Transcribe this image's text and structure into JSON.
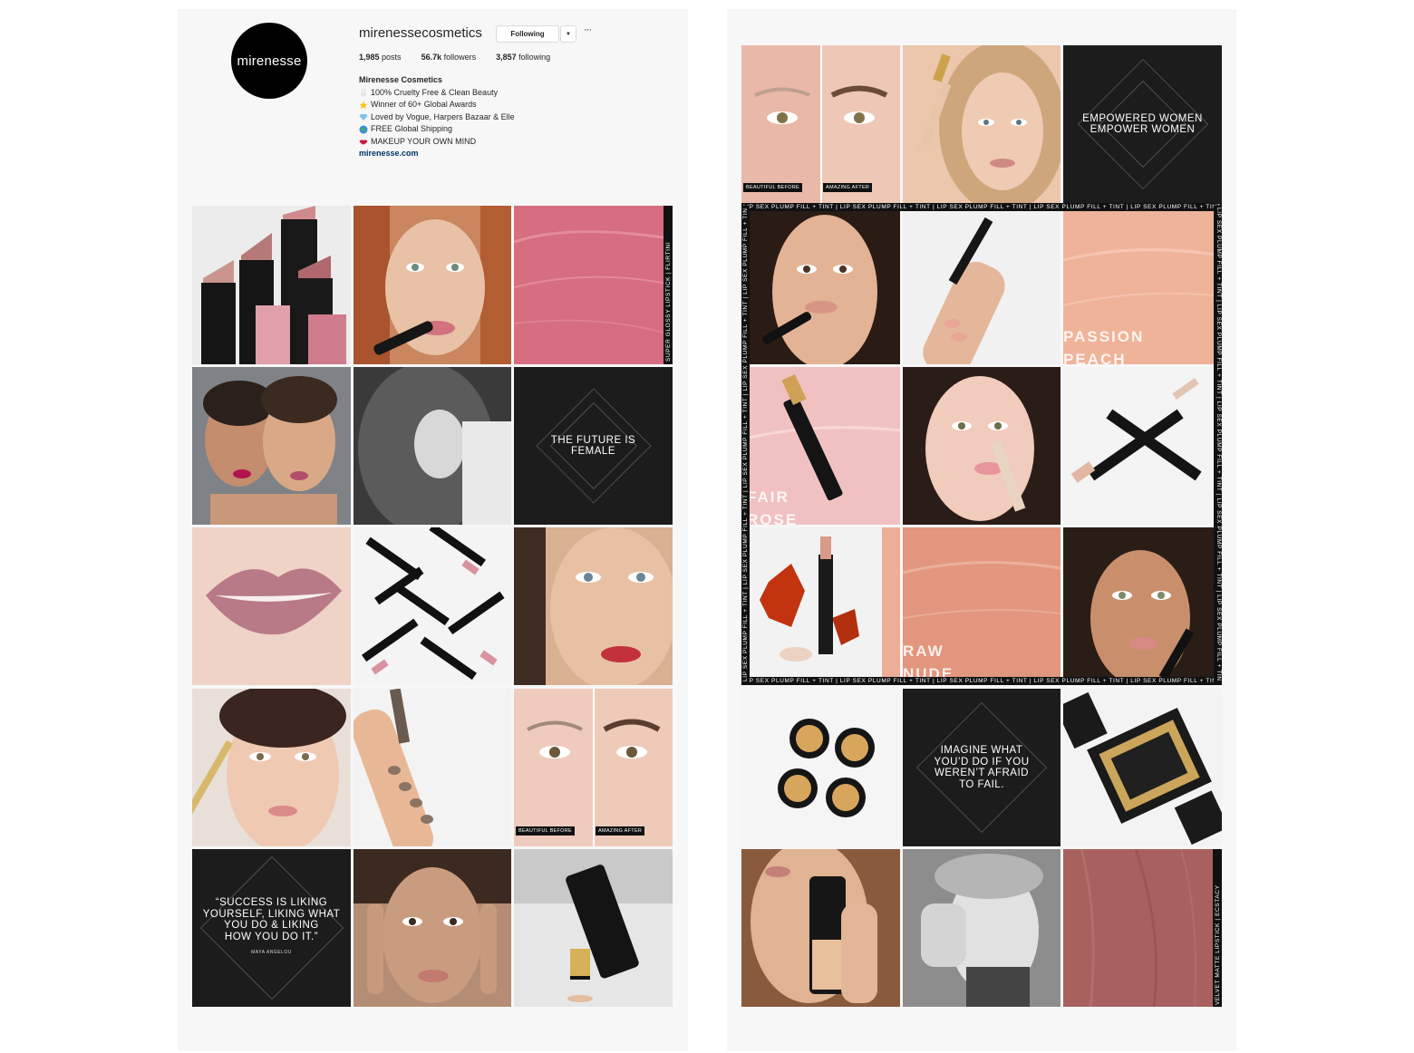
{
  "profile": {
    "avatar_text": "mirenesse",
    "username": "mirenessecosmetics",
    "follow_label": "Following",
    "dropdown_icon": "chevron-down-icon",
    "more_icon": "ellipsis-icon",
    "posts_count": "1,985",
    "posts_label": "posts",
    "followers_count": "56.7k",
    "followers_label": "followers",
    "following_count": "3,857",
    "following_label": "following",
    "display_name": "Mirenesse Cosmetics",
    "bio_lines": [
      {
        "icon": "bunny-emoji-icon",
        "text": "100% Cruelty Free & Clean Beauty"
      },
      {
        "icon": "star-emoji-icon",
        "text": "Winner of 60+ Global Awards"
      },
      {
        "icon": "diamond-emoji-icon",
        "text": "Loved by Vogue, Harpers Bazaar & Elle"
      },
      {
        "icon": "globe-emoji-icon",
        "text": "FREE Global Shipping"
      },
      {
        "icon": "lips-emoji-icon",
        "text": "MAKEUP YOUR OWN MIND"
      }
    ],
    "website": "mirenesse.com"
  },
  "left_grid": {
    "t3_vertical": "SUPER GLOSSY LIPSTICK | FLIRTINI",
    "t6_quote": [
      "THE FUTURE IS",
      "FEMALE"
    ],
    "t12_before": "BEAUTIFUL BEFORE",
    "t12_after": "AMAZING AFTER",
    "t13_quote": [
      "“SUCCESS IS LIKING",
      "YOURSELF, LIKING WHAT",
      "YOU DO & LIKING",
      "HOW YOU DO IT.”"
    ],
    "t13_author": "MAYA ANGELOU"
  },
  "right_grid": {
    "r1_before": "BEAUTIFUL BEFORE",
    "r1_after": "AMAZING AFTER",
    "r3_quote": [
      "EMPOWERED WOMEN",
      "EMPOWER WOMEN"
    ],
    "frame_text": "LIP SEX PLUMP FILL + TINT | LIP SEX PLUMP FILL + TINT | LIP SEX PLUMP FILL + TINT | LIP SEX PLUMP FILL + TINT | LIP SEX PLUMP FILL + TINT",
    "r6_label": [
      "PASSION",
      "PEACH"
    ],
    "r7_label": [
      "FAIR",
      "ROSE"
    ],
    "r11_label": [
      "RAW",
      "NUDE"
    ],
    "r14_quote": [
      "IMAGINE WHAT",
      "YOU’D DO IF YOU",
      "WEREN’T AFRAID",
      "TO FAIL."
    ],
    "r18_vertical": "VELVET MATTE LIPSTICK | ECSTACY"
  },
  "colors": {
    "panel_bg": "#f7f7f7",
    "quote_tile": "#1c1c1c",
    "lip_pink": "#d66d80",
    "peach": "#efb39a",
    "ecstacy": "#a8615f"
  }
}
